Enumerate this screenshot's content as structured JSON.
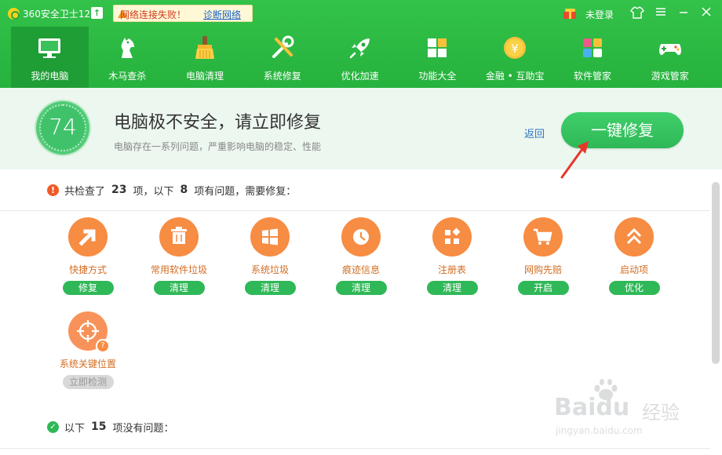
{
  "app": {
    "title": "360安全卫士12",
    "update_icon": "up-arrow-icon",
    "net_warning": "网络连接失败！",
    "net_diag_link": "诊断网络",
    "login": "未登录",
    "title_buttons": [
      "shirt-icon",
      "menu-icon",
      "minimize-icon",
      "close-icon"
    ]
  },
  "nav": [
    {
      "label": "我的电脑",
      "icon": "monitor-icon",
      "active": true
    },
    {
      "label": "木马查杀",
      "icon": "horse-icon"
    },
    {
      "label": "电脑清理",
      "icon": "broom-icon"
    },
    {
      "label": "系统修复",
      "icon": "tools-icon"
    },
    {
      "label": "优化加速",
      "icon": "rocket-icon"
    },
    {
      "label": "功能大全",
      "icon": "grid-icon"
    },
    {
      "label": "金融 • 互助宝",
      "icon": "coin-icon"
    },
    {
      "label": "软件管家",
      "icon": "apps-icon"
    },
    {
      "label": "游戏管家",
      "icon": "gamepad-icon"
    }
  ],
  "status": {
    "score": "74",
    "title": "电脑极不安全，请立即修复",
    "subtitle": "电脑存在一系列问题，严重影响电脑的稳定、性能",
    "back": "返回",
    "repair_button": "一键修复"
  },
  "summary_problems": {
    "prefix": "共检查了",
    "checked": "23",
    "middle": "项，以下",
    "issues": "8",
    "suffix": "项有问题，需要修复："
  },
  "issues": [
    {
      "label": "快捷方式",
      "action": "修复",
      "icon": "shortcut-arrow-icon"
    },
    {
      "label": "常用软件垃圾",
      "action": "清理",
      "icon": "trash-icon"
    },
    {
      "label": "系统垃圾",
      "action": "清理",
      "icon": "windows-icon"
    },
    {
      "label": "痕迹信息",
      "action": "清理",
      "icon": "clock-icon"
    },
    {
      "label": "注册表",
      "action": "清理",
      "icon": "registry-blocks-icon"
    },
    {
      "label": "网购先赔",
      "action": "开启",
      "icon": "cart-icon"
    },
    {
      "label": "启动项",
      "action": "优化",
      "icon": "double-chevron-up-icon"
    },
    {
      "label": "系统关键位置",
      "action": "立即检测",
      "icon": "crosshair-icon"
    }
  ],
  "summary_ok": {
    "prefix": "以下",
    "count": "15",
    "suffix": "项没有问题："
  },
  "watermark": {
    "brand": "Baidu",
    "cn": "经验",
    "url": "jingyan.baidu.com"
  },
  "colors": {
    "brand_green": "#26b23d",
    "issue_orange": "#f78c43",
    "action_green": "#2fb857",
    "alert_red": "#f05a28"
  }
}
